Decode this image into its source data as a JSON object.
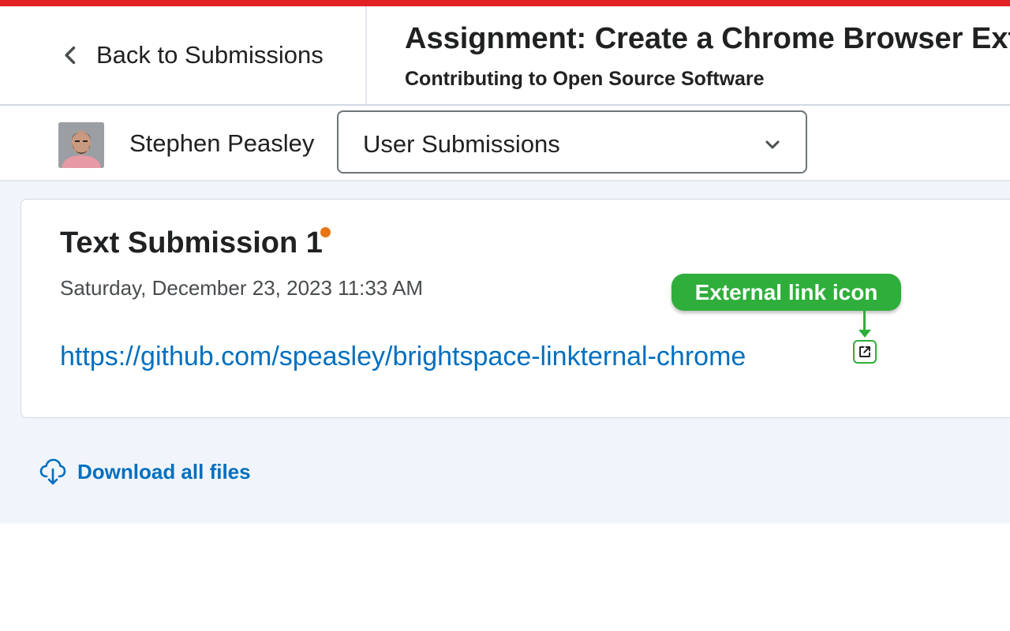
{
  "header": {
    "back_label": "Back to Submissions",
    "title": "Assignment: Create a Chrome Browser Ext",
    "course": "Contributing to Open Source Software"
  },
  "user": {
    "name": "Stephen Peasley",
    "view_select": {
      "selected": "User Submissions"
    }
  },
  "submission": {
    "title": "Text Submission 1",
    "date": "Saturday, December 23, 2023 11:33 AM",
    "link_text": "https://github.com/speasley/brightspace-linkternal-chrome"
  },
  "callout": {
    "label": "External link icon"
  },
  "download": {
    "label": "Download all files"
  },
  "icons": {
    "back": "chevron-left-icon",
    "select": "chevron-down-icon",
    "external": "external-link-icon",
    "download": "cloud-download-icon",
    "unread": "unread-dot-icon"
  },
  "colors": {
    "top_bar": "#e22222",
    "link": "#006fbf",
    "callout": "#2fae3b",
    "unread_dot": "#e87511",
    "content_bg": "#f1f5fb"
  }
}
